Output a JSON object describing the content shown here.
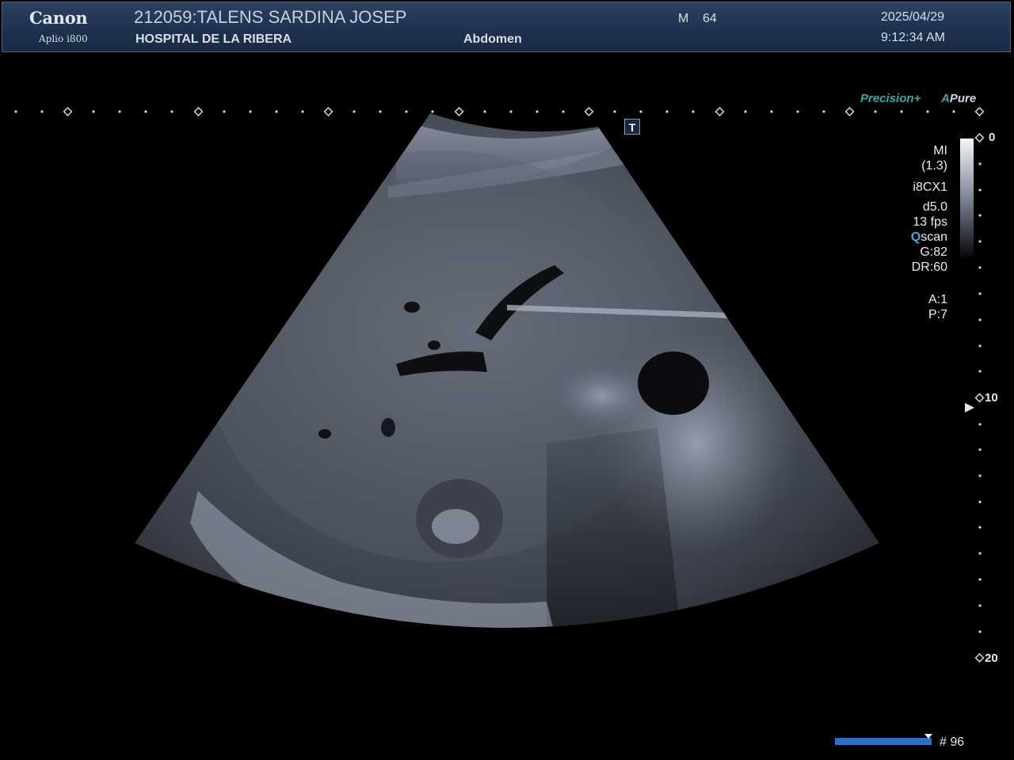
{
  "header": {
    "brand": "Canon",
    "model": "Aplio i800",
    "patient": "212059:TALENS SARDINA JOSEP",
    "hospital": "HOSPITAL DE LA RIBERA",
    "exam": "Abdomen",
    "sex": "M",
    "age": "64",
    "date": "2025/04/29",
    "time": "9:12:34 AM"
  },
  "imaging_tags": {
    "precision": "Precision",
    "precision_plus": "+",
    "pure_a": "A",
    "pure": "Pure"
  },
  "marker": {
    "label": "T"
  },
  "params": {
    "mi_label": "MI",
    "mi_value": "(1.3)",
    "probe": "i8CX1",
    "depth": "d5.0",
    "frame_rate": "13 fps",
    "scan_q": "Q",
    "scan_rest": "scan",
    "gain": "G:82",
    "dynamic_range": "DR:60",
    "a": "A:1",
    "p": "P:7"
  },
  "depth_scale": {
    "top": "0",
    "mid": "10",
    "bottom": "20"
  },
  "footer": {
    "frame_number": "# 96",
    "cine_progress": 1.0
  },
  "colors": {
    "header_bg": "#1f3150",
    "accent_teal": "#3aa8a8",
    "scan_q_blue": "#4aa8d8",
    "cine_bar": "#2f6fc8"
  }
}
